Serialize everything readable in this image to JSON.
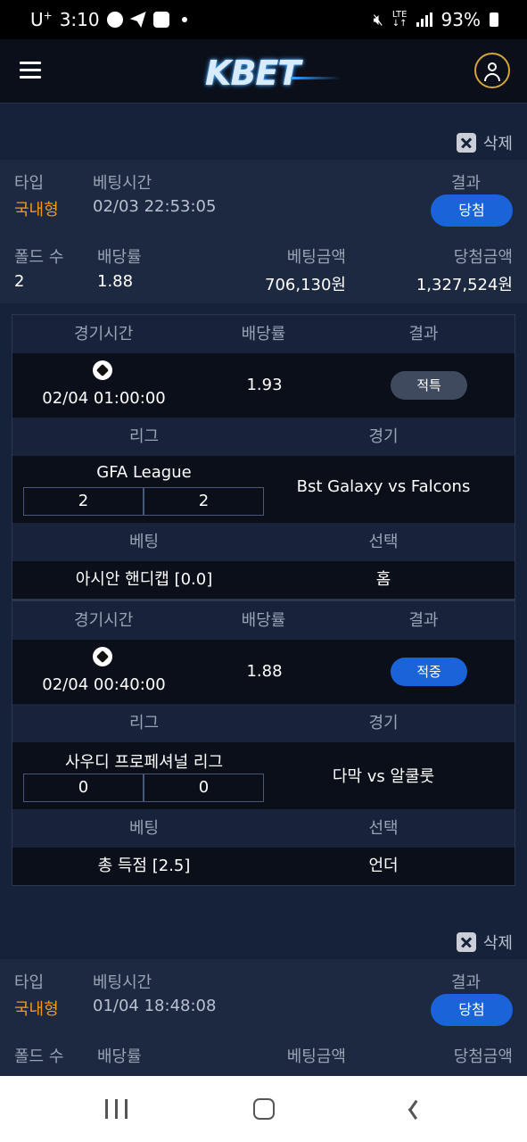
{
  "status_bar": {
    "time": "3:10",
    "carrier": "U",
    "carrier_sup": "+",
    "network": "LTE",
    "battery": "93%",
    "left_icons": [
      "chat-bubble-icon",
      "telegram-icon",
      "gallery-icon"
    ],
    "right_icons": [
      "mute-icon",
      "lte-icon",
      "signal-icon",
      "battery-icon"
    ]
  },
  "header": {
    "logo": "KBET",
    "menu_icon": "hamburger-icon",
    "profile_icon": "user-icon",
    "accent_color": "#d2a53a"
  },
  "colors": {
    "win_blue": "#1a63d9",
    "type_orange": "#f29a1e",
    "refund_gray": "#3f4a5e"
  },
  "slips": [
    {
      "delete_label": "삭제",
      "type_label": "타입",
      "type_value": "국내형",
      "time_label": "베팅시간",
      "time_value": "02/03 22:53:05",
      "result_label": "결과",
      "result_value": "당첨",
      "folds_label": "폴드 수",
      "folds_value": "2",
      "odds_label": "배당률",
      "odds_value": "1.88",
      "bet_amount_label": "베팅금액",
      "bet_amount_value": "706,130원",
      "win_amount_label": "당첨금액",
      "win_amount_value": "1,327,524원",
      "games": [
        {
          "h_time": "경기시간",
          "h_odds": "배당률",
          "h_result": "결과",
          "sport_icon": "soccer-ball-icon",
          "time": "02/04 01:00:00",
          "odds": "1.93",
          "result": "적특",
          "h_league": "리그",
          "h_match": "경기",
          "league": "GFA League",
          "score_home": "2",
          "score_away": "2",
          "match": "Bst Galaxy vs Falcons",
          "h_bet": "베팅",
          "h_pick": "선택",
          "bet": "아시안 핸디캡 [0.0]",
          "pick": "홈"
        },
        {
          "h_time": "경기시간",
          "h_odds": "배당률",
          "h_result": "결과",
          "sport_icon": "soccer-ball-icon",
          "time": "02/04 00:40:00",
          "odds": "1.88",
          "result": "적중",
          "h_league": "리그",
          "h_match": "경기",
          "league": "사우디 프로페셔널 리그",
          "score_home": "0",
          "score_away": "0",
          "match": "다막 vs 알쿨룻",
          "h_bet": "베팅",
          "h_pick": "선택",
          "bet": "총 득점 [2.5]",
          "pick": "언더"
        }
      ]
    },
    {
      "delete_label": "삭제",
      "type_label": "타입",
      "type_value": "국내형",
      "time_label": "베팅시간",
      "time_value": "01/04 18:48:08",
      "result_label": "결과",
      "result_value": "당첨",
      "folds_label": "폴드 수",
      "odds_label": "배당률",
      "bet_amount_label": "베팅금액",
      "win_amount_label": "당첨금액"
    }
  ],
  "nav_bar": {
    "icons": [
      "recent-apps-icon",
      "home-icon",
      "back-icon"
    ]
  }
}
